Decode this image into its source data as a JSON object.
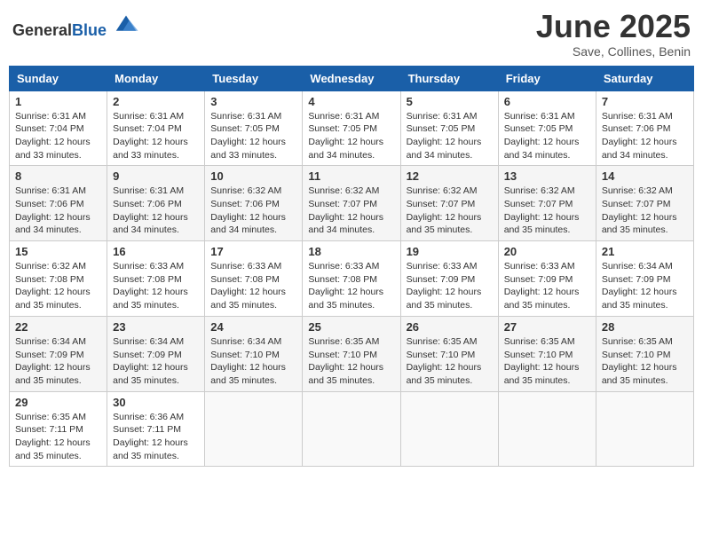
{
  "header": {
    "logo_general": "General",
    "logo_blue": "Blue",
    "month_title": "June 2025",
    "location": "Save, Collines, Benin"
  },
  "calendar": {
    "days_of_week": [
      "Sunday",
      "Monday",
      "Tuesday",
      "Wednesday",
      "Thursday",
      "Friday",
      "Saturday"
    ],
    "weeks": [
      [
        null,
        null,
        null,
        null,
        null,
        null,
        null
      ]
    ],
    "cells": [
      [
        {
          "day": 1,
          "sunrise": "6:31 AM",
          "sunset": "7:04 PM",
          "daylight": "12 hours and 33 minutes."
        },
        {
          "day": 2,
          "sunrise": "6:31 AM",
          "sunset": "7:04 PM",
          "daylight": "12 hours and 33 minutes."
        },
        {
          "day": 3,
          "sunrise": "6:31 AM",
          "sunset": "7:05 PM",
          "daylight": "12 hours and 33 minutes."
        },
        {
          "day": 4,
          "sunrise": "6:31 AM",
          "sunset": "7:05 PM",
          "daylight": "12 hours and 34 minutes."
        },
        {
          "day": 5,
          "sunrise": "6:31 AM",
          "sunset": "7:05 PM",
          "daylight": "12 hours and 34 minutes."
        },
        {
          "day": 6,
          "sunrise": "6:31 AM",
          "sunset": "7:05 PM",
          "daylight": "12 hours and 34 minutes."
        },
        {
          "day": 7,
          "sunrise": "6:31 AM",
          "sunset": "7:06 PM",
          "daylight": "12 hours and 34 minutes."
        }
      ],
      [
        {
          "day": 8,
          "sunrise": "6:31 AM",
          "sunset": "7:06 PM",
          "daylight": "12 hours and 34 minutes."
        },
        {
          "day": 9,
          "sunrise": "6:31 AM",
          "sunset": "7:06 PM",
          "daylight": "12 hours and 34 minutes."
        },
        {
          "day": 10,
          "sunrise": "6:32 AM",
          "sunset": "7:06 PM",
          "daylight": "12 hours and 34 minutes."
        },
        {
          "day": 11,
          "sunrise": "6:32 AM",
          "sunset": "7:07 PM",
          "daylight": "12 hours and 34 minutes."
        },
        {
          "day": 12,
          "sunrise": "6:32 AM",
          "sunset": "7:07 PM",
          "daylight": "12 hours and 35 minutes."
        },
        {
          "day": 13,
          "sunrise": "6:32 AM",
          "sunset": "7:07 PM",
          "daylight": "12 hours and 35 minutes."
        },
        {
          "day": 14,
          "sunrise": "6:32 AM",
          "sunset": "7:07 PM",
          "daylight": "12 hours and 35 minutes."
        }
      ],
      [
        {
          "day": 15,
          "sunrise": "6:32 AM",
          "sunset": "7:08 PM",
          "daylight": "12 hours and 35 minutes."
        },
        {
          "day": 16,
          "sunrise": "6:33 AM",
          "sunset": "7:08 PM",
          "daylight": "12 hours and 35 minutes."
        },
        {
          "day": 17,
          "sunrise": "6:33 AM",
          "sunset": "7:08 PM",
          "daylight": "12 hours and 35 minutes."
        },
        {
          "day": 18,
          "sunrise": "6:33 AM",
          "sunset": "7:08 PM",
          "daylight": "12 hours and 35 minutes."
        },
        {
          "day": 19,
          "sunrise": "6:33 AM",
          "sunset": "7:09 PM",
          "daylight": "12 hours and 35 minutes."
        },
        {
          "day": 20,
          "sunrise": "6:33 AM",
          "sunset": "7:09 PM",
          "daylight": "12 hours and 35 minutes."
        },
        {
          "day": 21,
          "sunrise": "6:34 AM",
          "sunset": "7:09 PM",
          "daylight": "12 hours and 35 minutes."
        }
      ],
      [
        {
          "day": 22,
          "sunrise": "6:34 AM",
          "sunset": "7:09 PM",
          "daylight": "12 hours and 35 minutes."
        },
        {
          "day": 23,
          "sunrise": "6:34 AM",
          "sunset": "7:09 PM",
          "daylight": "12 hours and 35 minutes."
        },
        {
          "day": 24,
          "sunrise": "6:34 AM",
          "sunset": "7:10 PM",
          "daylight": "12 hours and 35 minutes."
        },
        {
          "day": 25,
          "sunrise": "6:35 AM",
          "sunset": "7:10 PM",
          "daylight": "12 hours and 35 minutes."
        },
        {
          "day": 26,
          "sunrise": "6:35 AM",
          "sunset": "7:10 PM",
          "daylight": "12 hours and 35 minutes."
        },
        {
          "day": 27,
          "sunrise": "6:35 AM",
          "sunset": "7:10 PM",
          "daylight": "12 hours and 35 minutes."
        },
        {
          "day": 28,
          "sunrise": "6:35 AM",
          "sunset": "7:10 PM",
          "daylight": "12 hours and 35 minutes."
        }
      ],
      [
        {
          "day": 29,
          "sunrise": "6:35 AM",
          "sunset": "7:11 PM",
          "daylight": "12 hours and 35 minutes."
        },
        {
          "day": 30,
          "sunrise": "6:36 AM",
          "sunset": "7:11 PM",
          "daylight": "12 hours and 35 minutes."
        },
        null,
        null,
        null,
        null,
        null
      ]
    ]
  }
}
